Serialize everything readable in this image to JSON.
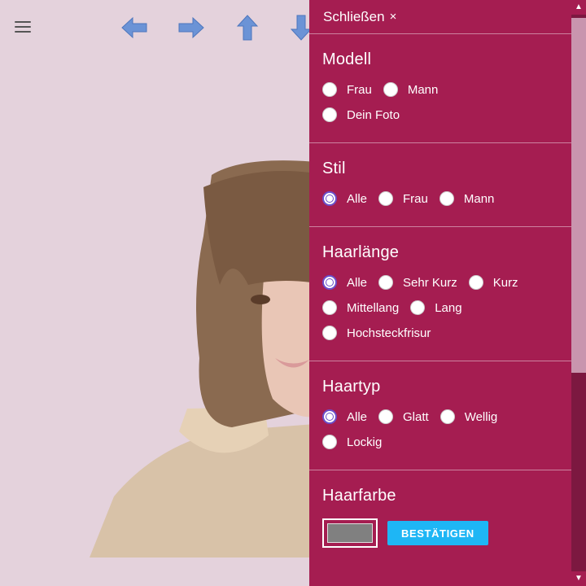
{
  "toolbar": {
    "menu_icon": "hamburger-menu-icon",
    "arrows": [
      "arrow-left-icon",
      "arrow-right-icon",
      "arrow-up-icon",
      "arrow-down-icon"
    ],
    "arrow_color": "#6b93d6"
  },
  "panel": {
    "close_label": "Schließen",
    "close_symbol": "×",
    "background": "#a51d51",
    "sections": {
      "modell": {
        "title": "Modell",
        "options": [
          "Frau",
          "Mann",
          "Dein Foto"
        ],
        "selected": null
      },
      "stil": {
        "title": "Stil",
        "options": [
          "Alle",
          "Frau",
          "Mann"
        ],
        "selected": "Alle"
      },
      "haarlaenge": {
        "title": "Haarlänge",
        "options": [
          "Alle",
          "Sehr Kurz",
          "Kurz",
          "Mittellang",
          "Lang",
          "Hochsteckfrisur"
        ],
        "selected": "Alle"
      },
      "haartyp": {
        "title": "Haartyp",
        "options": [
          "Alle",
          "Glatt",
          "Wellig",
          "Lockig"
        ],
        "selected": "Alle"
      },
      "haarfarbe": {
        "title": "Haarfarbe",
        "swatch_color": "#808080",
        "confirm_label": "BESTÄTIGEN"
      }
    }
  },
  "scrollbar": {
    "up_symbol": "▲",
    "down_symbol": "▼",
    "scroll_fraction": 0.0
  }
}
